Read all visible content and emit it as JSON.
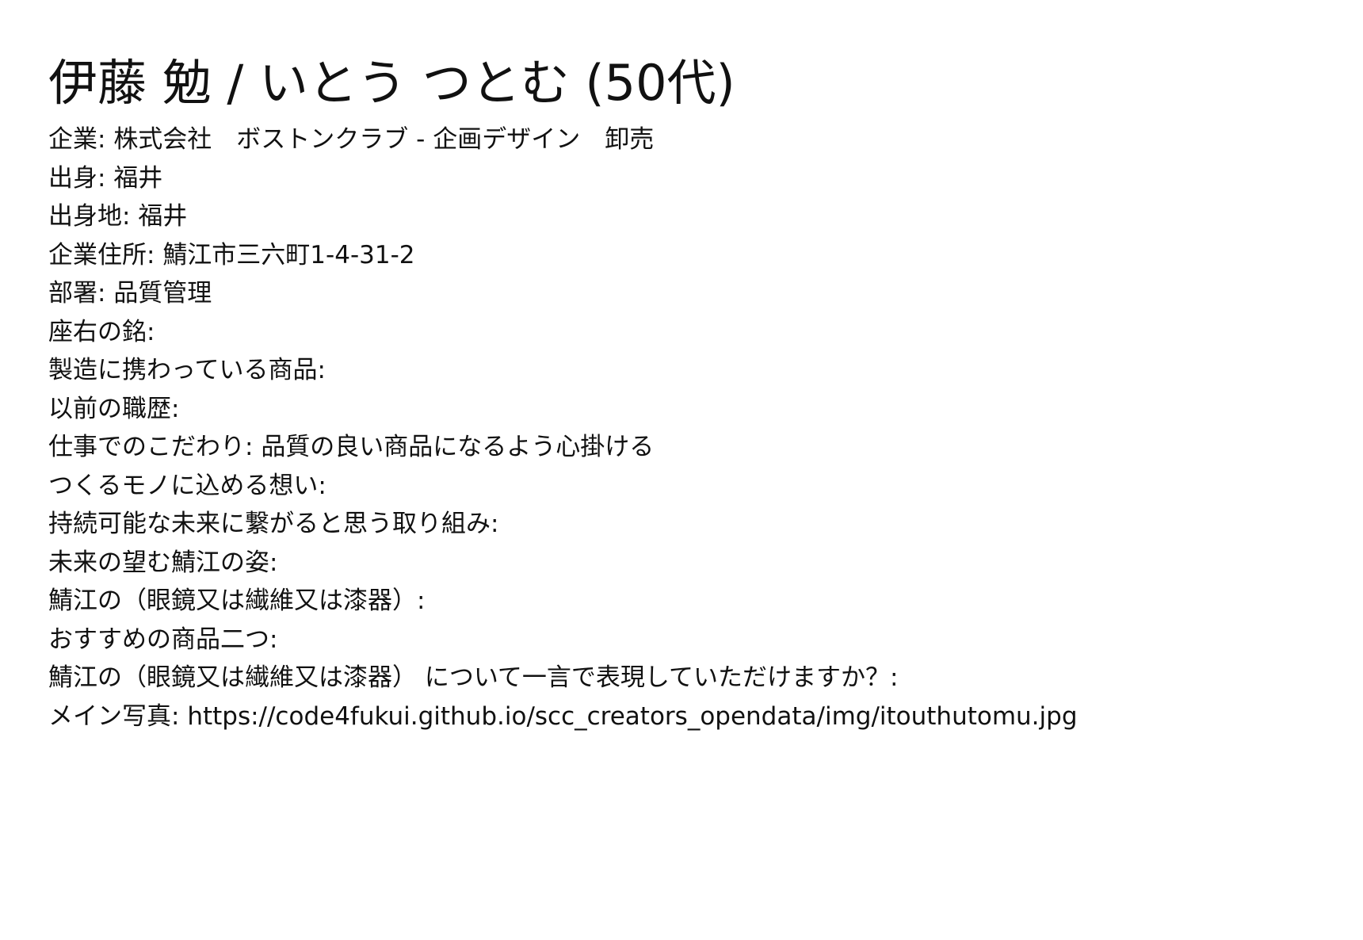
{
  "profile": {
    "title": "伊藤 勉 / いとう つとむ (50代)",
    "separator": ": ",
    "fields": [
      {
        "label": "企業",
        "value": "株式会社　ボストンクラブ - 企画デザイン　卸売"
      },
      {
        "label": "出身",
        "value": "福井"
      },
      {
        "label": "出身地",
        "value": "福井"
      },
      {
        "label": "企業住所",
        "value": "鯖江市三六町1-4-31-2"
      },
      {
        "label": "部署",
        "value": "品質管理"
      },
      {
        "label": "座右の銘",
        "value": ""
      },
      {
        "label": "製造に携わっている商品",
        "value": ""
      },
      {
        "label": "以前の職歴",
        "value": ""
      },
      {
        "label": "仕事でのこだわり",
        "value": "品質の良い商品になるよう心掛ける"
      },
      {
        "label": "つくるモノに込める想い",
        "value": ""
      },
      {
        "label": "持続可能な未来に繋がると思う取り組み",
        "value": ""
      },
      {
        "label": "未来の望む鯖江の姿",
        "value": ""
      },
      {
        "label": "鯖江の（眼鏡又は繊維又は漆器）",
        "value": ""
      },
      {
        "label": "おすすめの商品二つ",
        "value": ""
      },
      {
        "label": "鯖江の（眼鏡又は繊維又は漆器） について一言で表現していただけますか？",
        "value": ""
      },
      {
        "label": "メイン写真",
        "value": "https://code4fukui.github.io/scc_creators_opendata/img/itouthutomu.jpg"
      }
    ]
  }
}
